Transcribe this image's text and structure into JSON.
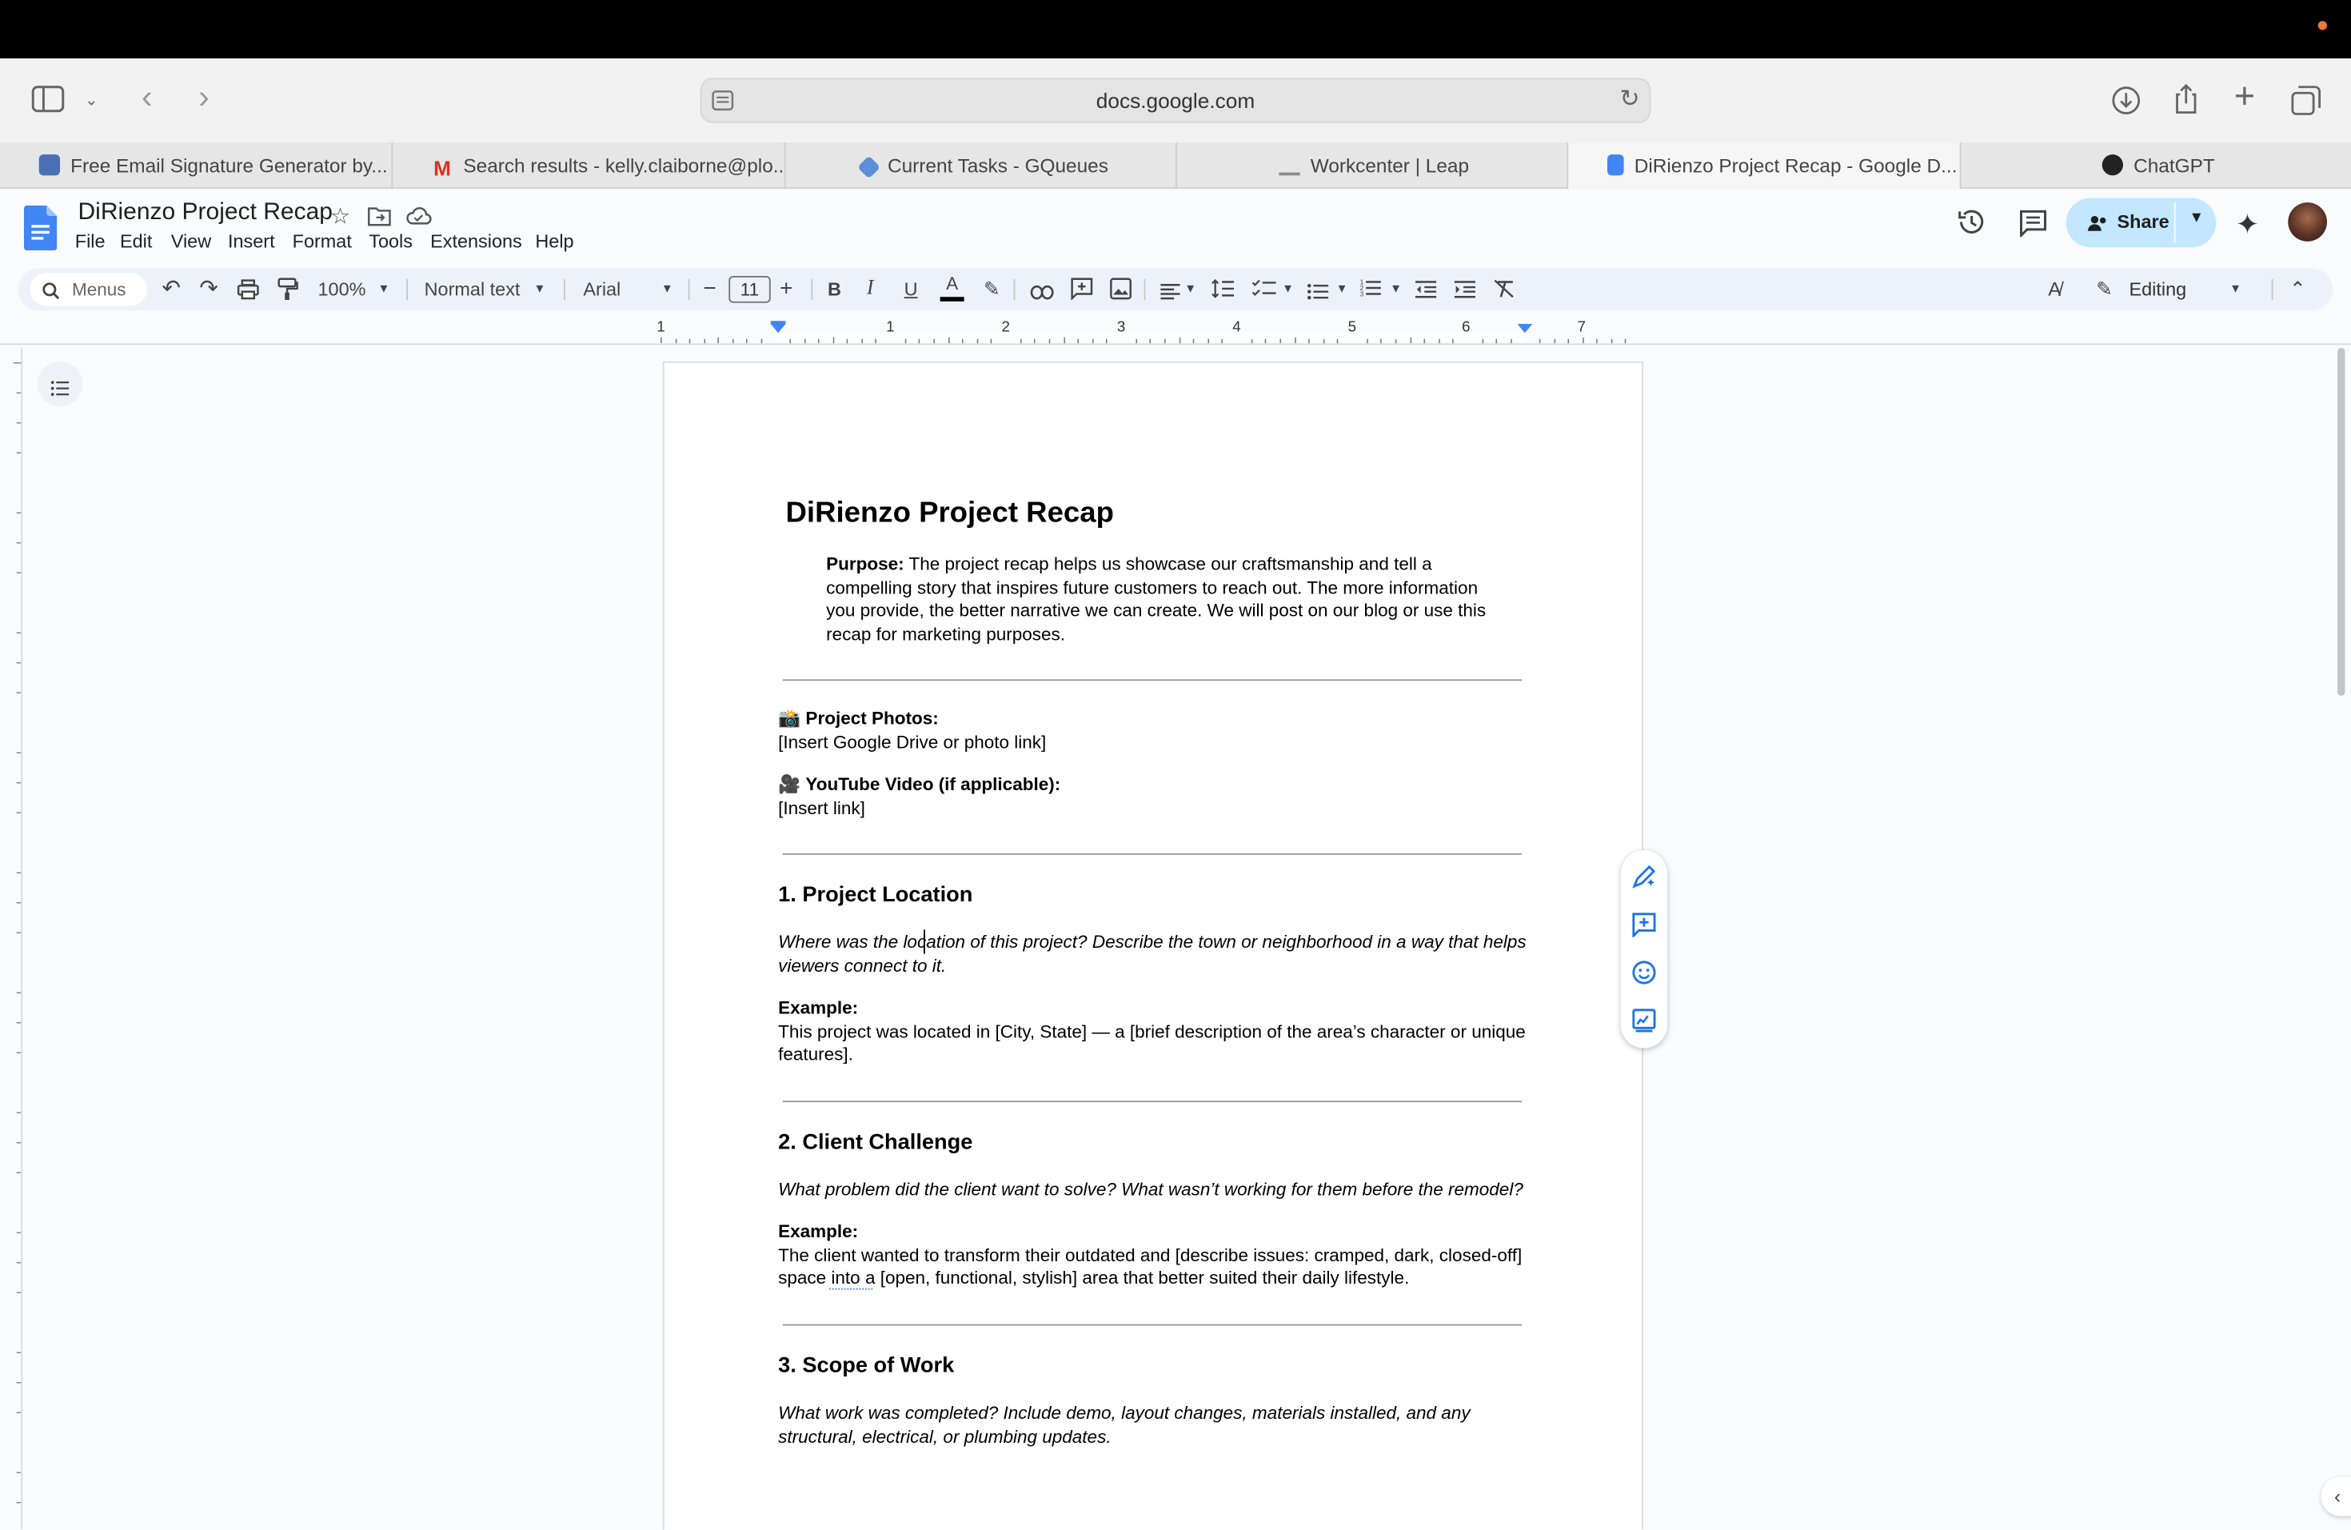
{
  "browser": {
    "url": "docs.google.com",
    "tabs": [
      {
        "label": "Free Email Signature Generator by...",
        "icon": "mailchimp-icon",
        "color": "#4a6fb5",
        "active": false
      },
      {
        "label": "Search results - kelly.claiborne@plo...",
        "icon": "gmail-icon",
        "color": "#d93025",
        "active": false
      },
      {
        "label": "Current Tasks - GQueues",
        "icon": "gqueues-icon",
        "color": "#5b8fd6",
        "active": false
      },
      {
        "label": "Workcenter | Leap",
        "icon": "leap-icon",
        "color": "#8a8a8a",
        "active": false
      },
      {
        "label": "DiRienzo Project Recap - Google D...",
        "icon": "google-docs-icon",
        "color": "#4285f4",
        "active": true
      },
      {
        "label": "ChatGPT",
        "icon": "chatgpt-icon",
        "color": "#222222",
        "active": false
      }
    ]
  },
  "docs": {
    "title": "DiRienzo Project Recap",
    "menus": [
      "File",
      "Edit",
      "View",
      "Insert",
      "Format",
      "Tools",
      "Extensions",
      "Help"
    ],
    "share_label": "Share",
    "toolbar": {
      "search_menus": "Menus",
      "zoom": "100%",
      "style": "Normal text",
      "font": "Arial",
      "font_size": "11",
      "mode": "Editing"
    },
    "ruler_numbers": [
      "1",
      "1",
      "2",
      "3",
      "4",
      "5",
      "6",
      "7"
    ]
  },
  "document": {
    "heading": "DiRienzo Project Recap",
    "purpose_label": "Purpose:",
    "purpose_lines": [
      "The project recap helps us showcase our craftsmanship and tell a",
      "compelling story that inspires future customers to reach out. The more information",
      "you provide, the better narrative we can create. We will post on our blog or use this",
      "recap for marketing purposes."
    ],
    "photos_emoji": "📸",
    "photos_label": "Project Photos:",
    "photos_value": "[Insert Google Drive or photo link]",
    "video_emoji": "🎥",
    "video_label": "YouTube Video (if applicable):",
    "video_value": "[Insert link]",
    "sections": [
      {
        "heading": "1. Project Location",
        "prompt_lines": [
          "Where was the location of this project? Describe the town or neighborhood in a way that helps",
          "viewers connect to it."
        ],
        "example_label": "Example:",
        "example_lines": [
          "This project was located in [City, State] — a [brief description of the area’s character or unique",
          "features]."
        ]
      },
      {
        "heading": "2. Client Challenge",
        "prompt_lines": [
          "What problem did the client want to solve? What wasn’t working for them before the remodel?"
        ],
        "example_label": "Example:",
        "example_lines": [
          "The client wanted to transform their outdated and [describe issues: cramped, dark, closed-off]",
          "space into a [open, functional, stylish] area that better suited their daily lifestyle."
        ]
      },
      {
        "heading": "3. Scope of Work",
        "prompt_lines": [
          "What work was completed? Include demo, layout changes, materials installed, and any",
          "structural, electrical, or plumbing updates."
        ]
      }
    ]
  }
}
